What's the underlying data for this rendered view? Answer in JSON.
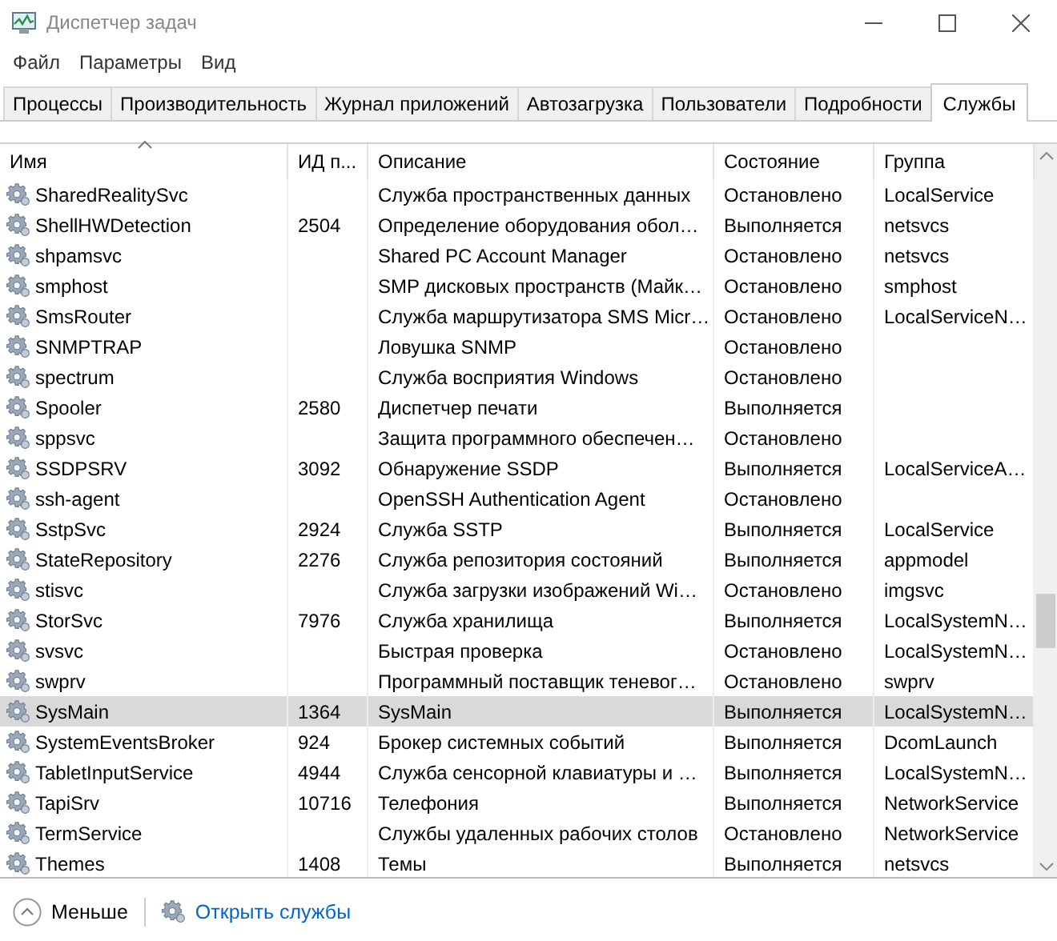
{
  "window": {
    "title": "Диспетчер задач"
  },
  "menu": [
    {
      "label": "Файл"
    },
    {
      "label": "Параметры"
    },
    {
      "label": "Вид"
    }
  ],
  "tabs": [
    {
      "label": "Процессы",
      "selected": false
    },
    {
      "label": "Производительность",
      "selected": false
    },
    {
      "label": "Журнал приложений",
      "selected": false
    },
    {
      "label": "Автозагрузка",
      "selected": false
    },
    {
      "label": "Пользователи",
      "selected": false
    },
    {
      "label": "Подробности",
      "selected": false
    },
    {
      "label": "Службы",
      "selected": true
    }
  ],
  "table": {
    "columns": [
      {
        "label": "Имя",
        "sorted": true
      },
      {
        "label": "ИД п...",
        "sorted": false
      },
      {
        "label": "Описание",
        "sorted": false
      },
      {
        "label": "Состояние",
        "sorted": false
      },
      {
        "label": "Группа",
        "sorted": false
      }
    ],
    "rows": [
      {
        "name": "SharedRealitySvc",
        "pid": "",
        "description": "Служба пространственных данных",
        "status": "Остановлено",
        "group": "LocalService",
        "selected": false
      },
      {
        "name": "ShellHWDetection",
        "pid": "2504",
        "description": "Определение оборудования обол…",
        "status": "Выполняется",
        "group": "netsvcs",
        "selected": false
      },
      {
        "name": "shpamsvc",
        "pid": "",
        "description": "Shared PC Account Manager",
        "status": "Остановлено",
        "group": "netsvcs",
        "selected": false
      },
      {
        "name": "smphost",
        "pid": "",
        "description": "SMP дисковых пространств (Майк…",
        "status": "Остановлено",
        "group": "smphost",
        "selected": false
      },
      {
        "name": "SmsRouter",
        "pid": "",
        "description": "Служба маршрутизатора SMS Micr…",
        "status": "Остановлено",
        "group": "LocalServiceN…",
        "selected": false
      },
      {
        "name": "SNMPTRAP",
        "pid": "",
        "description": "Ловушка SNMP",
        "status": "Остановлено",
        "group": "",
        "selected": false
      },
      {
        "name": "spectrum",
        "pid": "",
        "description": "Служба восприятия Windows",
        "status": "Остановлено",
        "group": "",
        "selected": false
      },
      {
        "name": "Spooler",
        "pid": "2580",
        "description": "Диспетчер печати",
        "status": "Выполняется",
        "group": "",
        "selected": false
      },
      {
        "name": "sppsvc",
        "pid": "",
        "description": "Защита программного обеспечен…",
        "status": "Остановлено",
        "group": "",
        "selected": false
      },
      {
        "name": "SSDPSRV",
        "pid": "3092",
        "description": "Обнаружение SSDP",
        "status": "Выполняется",
        "group": "LocalServiceA…",
        "selected": false
      },
      {
        "name": "ssh-agent",
        "pid": "",
        "description": "OpenSSH Authentication Agent",
        "status": "Остановлено",
        "group": "",
        "selected": false
      },
      {
        "name": "SstpSvc",
        "pid": "2924",
        "description": "Служба SSTP",
        "status": "Выполняется",
        "group": "LocalService",
        "selected": false
      },
      {
        "name": "StateRepository",
        "pid": "2276",
        "description": "Служба репозитория состояний",
        "status": "Выполняется",
        "group": "appmodel",
        "selected": false
      },
      {
        "name": "stisvc",
        "pid": "",
        "description": "Служба загрузки изображений Wi…",
        "status": "Остановлено",
        "group": "imgsvc",
        "selected": false
      },
      {
        "name": "StorSvc",
        "pid": "7976",
        "description": "Служба хранилища",
        "status": "Выполняется",
        "group": "LocalSystemN…",
        "selected": false
      },
      {
        "name": "svsvc",
        "pid": "",
        "description": "Быстрая проверка",
        "status": "Остановлено",
        "group": "LocalSystemN…",
        "selected": false
      },
      {
        "name": "swprv",
        "pid": "",
        "description": "Программный поставщик теневог…",
        "status": "Остановлено",
        "group": "swprv",
        "selected": false
      },
      {
        "name": "SysMain",
        "pid": "1364",
        "description": "SysMain",
        "status": "Выполняется",
        "group": "LocalSystemN…",
        "selected": true
      },
      {
        "name": "SystemEventsBroker",
        "pid": "924",
        "description": "Брокер системных событий",
        "status": "Выполняется",
        "group": "DcomLaunch",
        "selected": false
      },
      {
        "name": "TabletInputService",
        "pid": "4944",
        "description": "Служба сенсорной клавиатуры и …",
        "status": "Выполняется",
        "group": "LocalSystemN…",
        "selected": false
      },
      {
        "name": "TapiSrv",
        "pid": "10716",
        "description": "Телефония",
        "status": "Выполняется",
        "group": "NetworkService",
        "selected": false
      },
      {
        "name": "TermService",
        "pid": "",
        "description": "Службы удаленных рабочих столов",
        "status": "Остановлено",
        "group": "NetworkService",
        "selected": false
      },
      {
        "name": "Themes",
        "pid": "1408",
        "description": "Темы",
        "status": "Выполняется",
        "group": "netsvcs",
        "selected": false
      }
    ]
  },
  "footer": {
    "less": "Меньше",
    "open_services": "Открыть службы"
  }
}
